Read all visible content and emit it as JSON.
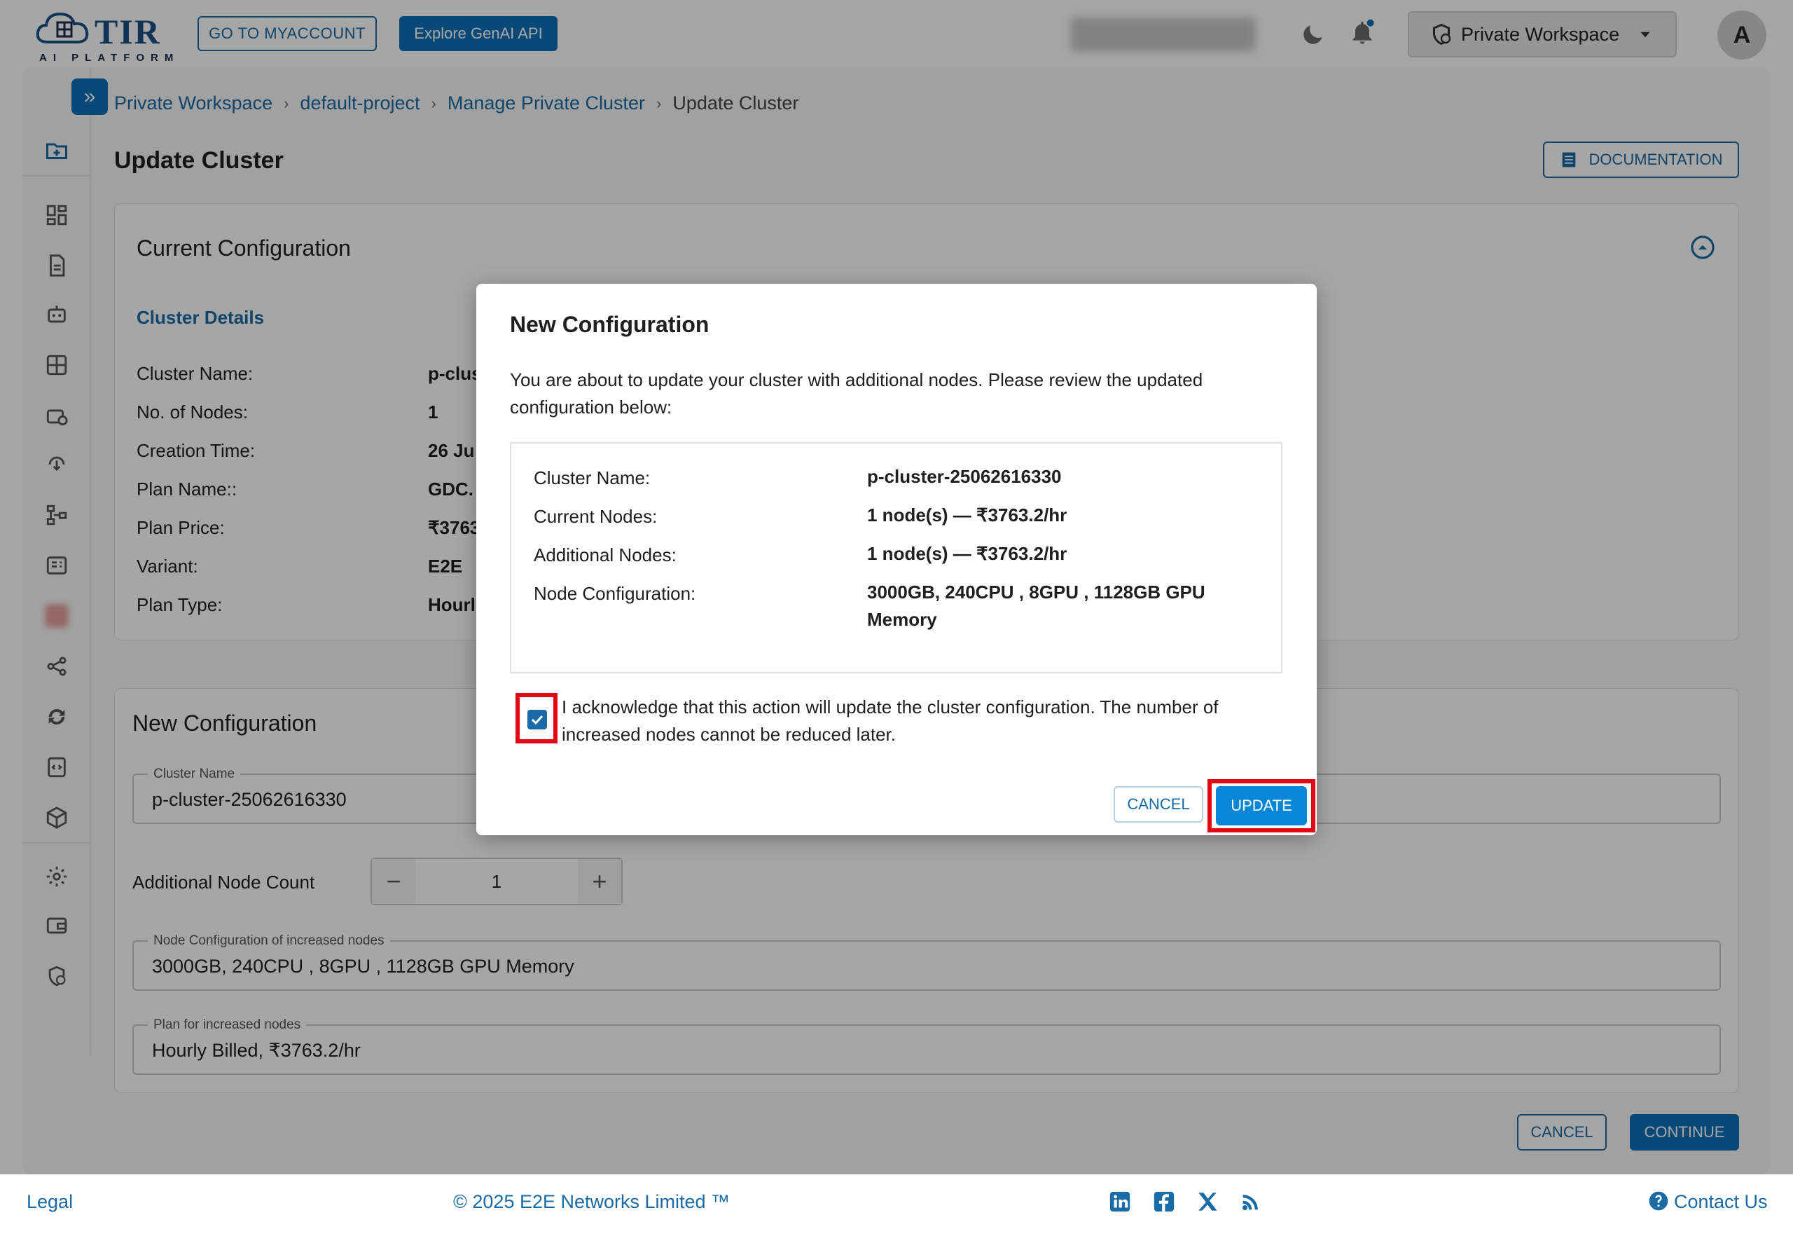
{
  "topbar": {
    "logo_text": "TIR",
    "logo_sub": "AI PLATFORM",
    "myaccount_label": "GO TO MYACCOUNT",
    "genai_label": "Explore GenAI API",
    "workspace_label": "Private Workspace",
    "avatar_letter": "A"
  },
  "breadcrumb": {
    "items": [
      "Private Workspace",
      "default-project",
      "Manage Private Cluster"
    ],
    "current": "Update Cluster",
    "separator": "›"
  },
  "page": {
    "title": "Update Cluster",
    "documentation_label": "DOCUMENTATION"
  },
  "current_config": {
    "title": "Current Configuration",
    "section": "Cluster Details",
    "rows": [
      {
        "label": "Cluster Name:",
        "value": "p-clus"
      },
      {
        "label": "No. of Nodes:",
        "value": "1"
      },
      {
        "label": "Creation Time:",
        "value": "26 Ju"
      },
      {
        "label": "Plan Name::",
        "value": "GDC."
      },
      {
        "label": "Plan Price:",
        "value": "₹3763"
      },
      {
        "label": "Variant:",
        "value": "E2E"
      },
      {
        "label": "Plan Type:",
        "value": "Hourl"
      }
    ]
  },
  "new_config": {
    "title": "New Configuration",
    "cluster_name_label": "Cluster Name",
    "cluster_name_value": "p-cluster-25062616330",
    "additional_node_label": "Additional Node Count",
    "additional_node_value": "1",
    "node_config_label": "Node Configuration of increased nodes",
    "node_config_value": "3000GB, 240CPU , 8GPU , 1128GB GPU Memory",
    "plan_label": "Plan for increased nodes",
    "plan_value": "Hourly Billed, ₹3763.2/hr",
    "cancel_label": "CANCEL",
    "continue_label": "CONTINUE"
  },
  "modal": {
    "title": "New Configuration",
    "description": "You are about to update your cluster with additional nodes. Please review the updated configuration below:",
    "rows": [
      {
        "label": "Cluster Name:",
        "value": "p-cluster-25062616330"
      },
      {
        "label": "Current Nodes:",
        "value": "1 node(s) — ₹3763.2/hr"
      },
      {
        "label": "Additional Nodes:",
        "value": "1 node(s) — ₹3763.2/hr"
      },
      {
        "label": "Node Configuration:",
        "value": "3000GB, 240CPU , 8GPU , 1128GB GPU Memory"
      }
    ],
    "acknowledge_text": "I acknowledge that this action will update the cluster configuration. The number of increased nodes cannot be reduced later.",
    "acknowledge_checked": true,
    "cancel_label": "CANCEL",
    "update_label": "UPDATE"
  },
  "footer": {
    "legal": "Legal",
    "copyright": "© 2025 E2E Networks Limited ™",
    "contact": "Contact Us"
  },
  "colors": {
    "brand": "#1a6aa5",
    "button_fill": "#0a6fb6",
    "highlight": "#e30613"
  }
}
